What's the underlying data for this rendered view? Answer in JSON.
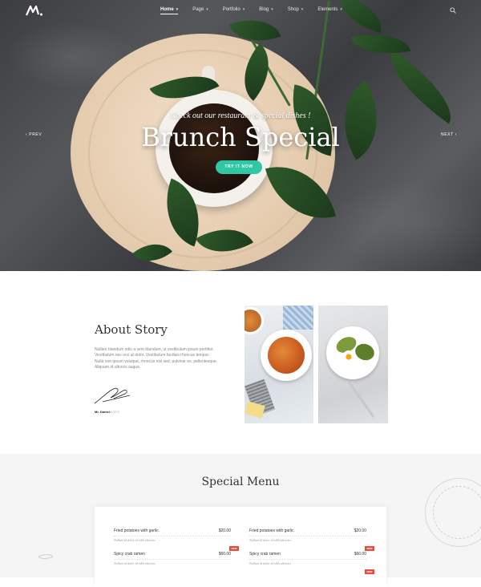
{
  "nav": {
    "items": [
      {
        "label": "Home",
        "chevron": "chevron-down-icon"
      },
      {
        "label": "Page",
        "chevron": "chevron-down-icon"
      },
      {
        "label": "Portfolio",
        "chevron": "chevron-down-icon"
      },
      {
        "label": "Blog",
        "chevron": "chevron-down-icon"
      },
      {
        "label": "Shop",
        "chevron": "chevron-down-icon"
      },
      {
        "label": "Elements",
        "chevron": "chevron-down-icon"
      }
    ]
  },
  "hero": {
    "subtitle": "Check out our restaurant & special dishes !",
    "title": "Brunch Special",
    "cta": "TRY IT NOW",
    "prev": "‹ PREV",
    "next": "NEXT ›"
  },
  "about": {
    "title": "About Story",
    "text": "Nullam blandum odio a sem blandum, ut vestibulum ipsum porttitor. Vestibulum nec orci at dolor. Vestibulum facilisis rhoncus tempor. Nulla non ipsum volutpat, rhoncus nisl sed, pulvinar ex. pellentesque. Aliquam id ultrices augue.",
    "author": "Mr. Daniel",
    "role": "CEO"
  },
  "special_menu": {
    "title": "Special Menu",
    "dishes": [
      {
        "name": "Fried potatoes with garlic",
        "price": "$20.00",
        "desc": "Nullam id dolor id nibh ultricies"
      },
      {
        "name": "Fried potatoes with garlic",
        "price": "$20.00",
        "desc": "Nullam id dolor id nibh ultricies"
      },
      {
        "name": "Spicy crab ramen",
        "price": "$60.00",
        "desc": "Nullam id dolor id nibh ultricies",
        "badge": "NEW"
      },
      {
        "name": "Spicy crab ramen",
        "price": "$60.00",
        "desc": "Nullam id dolor id nibh ultricies",
        "badge": "NEW"
      }
    ],
    "badge_extra": "NEW"
  },
  "colors": {
    "accent": "#2fc7a4",
    "badge": "#e74c3c",
    "hero_dark": "#3c3d40"
  }
}
